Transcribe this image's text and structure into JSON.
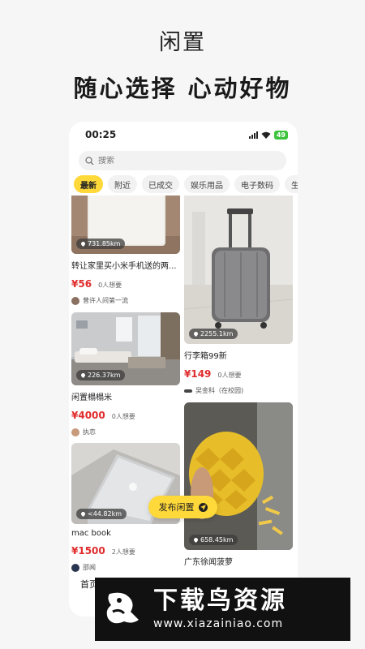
{
  "hero": {
    "title": "闲置",
    "slogan": "随心选择  心动好物"
  },
  "status_bar": {
    "time": "00:25",
    "battery": "49"
  },
  "search": {
    "placeholder": "搜索"
  },
  "tabs": [
    "最新",
    "附近",
    "已成交",
    "娱乐用品",
    "电子数码",
    "生活"
  ],
  "listings": [
    {
      "distance": "731.85km",
      "title": "转让家里买小米手机送的两...",
      "price": "¥56",
      "wants": "0人想要",
      "seller": "曾许人间第一流"
    },
    {
      "distance": "2255.1km",
      "title": "行李箱99新",
      "price": "¥149",
      "wants": "0人想要",
      "seller": "吴金科（在校园)"
    },
    {
      "distance": "226.37km",
      "title": "闲置榻榻米",
      "price": "¥4000",
      "wants": "0人想要",
      "seller": "执恋"
    },
    {
      "distance": "658.45km",
      "title": "广东徐闻菠萝",
      "price": "",
      "wants": "",
      "seller": ""
    },
    {
      "distance": "<44.82km",
      "title": "mac book",
      "price": "¥1500",
      "wants": "2人想要",
      "seller": "邵闻"
    }
  ],
  "fab": {
    "label": "发布闲置"
  },
  "bottom_nav": {
    "home": "首页"
  },
  "watermark": {
    "name": "下载鸟资源",
    "url": "www.xiazainiao.com"
  },
  "colors": {
    "accent": "#ffd83a",
    "price": "#e02b2b",
    "nav_marker": "#e8334a"
  }
}
